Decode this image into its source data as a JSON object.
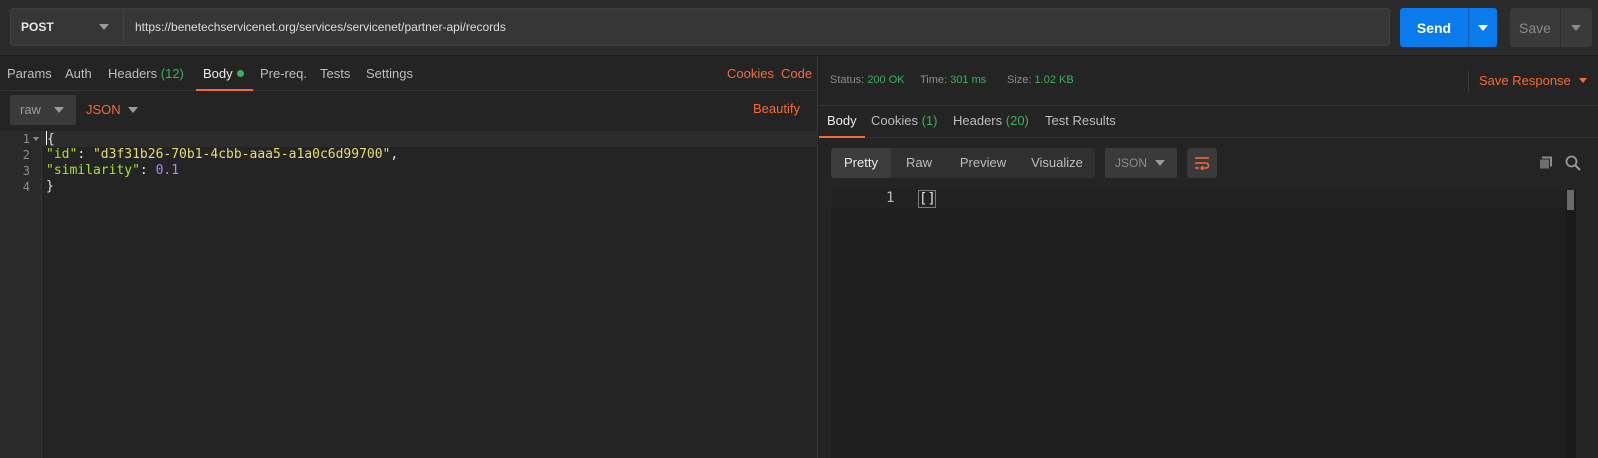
{
  "request": {
    "method": "POST",
    "url": "https://benetechservicenet.org/services/servicenet/partner-api/records",
    "send_label": "Send",
    "save_label": "Save"
  },
  "request_tabs": {
    "params": "Params",
    "auth": "Auth",
    "headers": "Headers",
    "headers_count": "(12)",
    "body": "Body",
    "prereq": "Pre-req.",
    "tests": "Tests",
    "settings": "Settings",
    "cookies": "Cookies",
    "code": "Code"
  },
  "body_options": {
    "mode": "raw",
    "format": "JSON",
    "beautify": "Beautify"
  },
  "editor": {
    "line_numbers": [
      "1",
      "2",
      "3",
      "4"
    ],
    "open_brace": "{",
    "close_brace": "}",
    "id_key": "\"id\"",
    "id_value": "\"d3f31b26-70b1-4cbb-aaa5-a1a0c6d99700\"",
    "similarity_key": "\"similarity\"",
    "similarity_value": "0.1"
  },
  "response_status": {
    "status_label": "Status:",
    "status_value": "200 OK",
    "time_label": "Time:",
    "time_value": "301 ms",
    "size_label": "Size:",
    "size_value": "1.02 KB",
    "save_response": "Save Response"
  },
  "response_tabs": {
    "body": "Body",
    "cookies": "Cookies",
    "cookies_count": "(1)",
    "headers": "Headers",
    "headers_count": "(20)",
    "test_results": "Test Results"
  },
  "view_modes": [
    "Pretty",
    "Raw",
    "Preview",
    "Visualize"
  ],
  "response_format": "JSON",
  "response_body": {
    "line_number": "1",
    "content": "[]"
  },
  "colors": {
    "accent": "#f26b3a",
    "send": "#097bed",
    "success": "#3fae60"
  }
}
